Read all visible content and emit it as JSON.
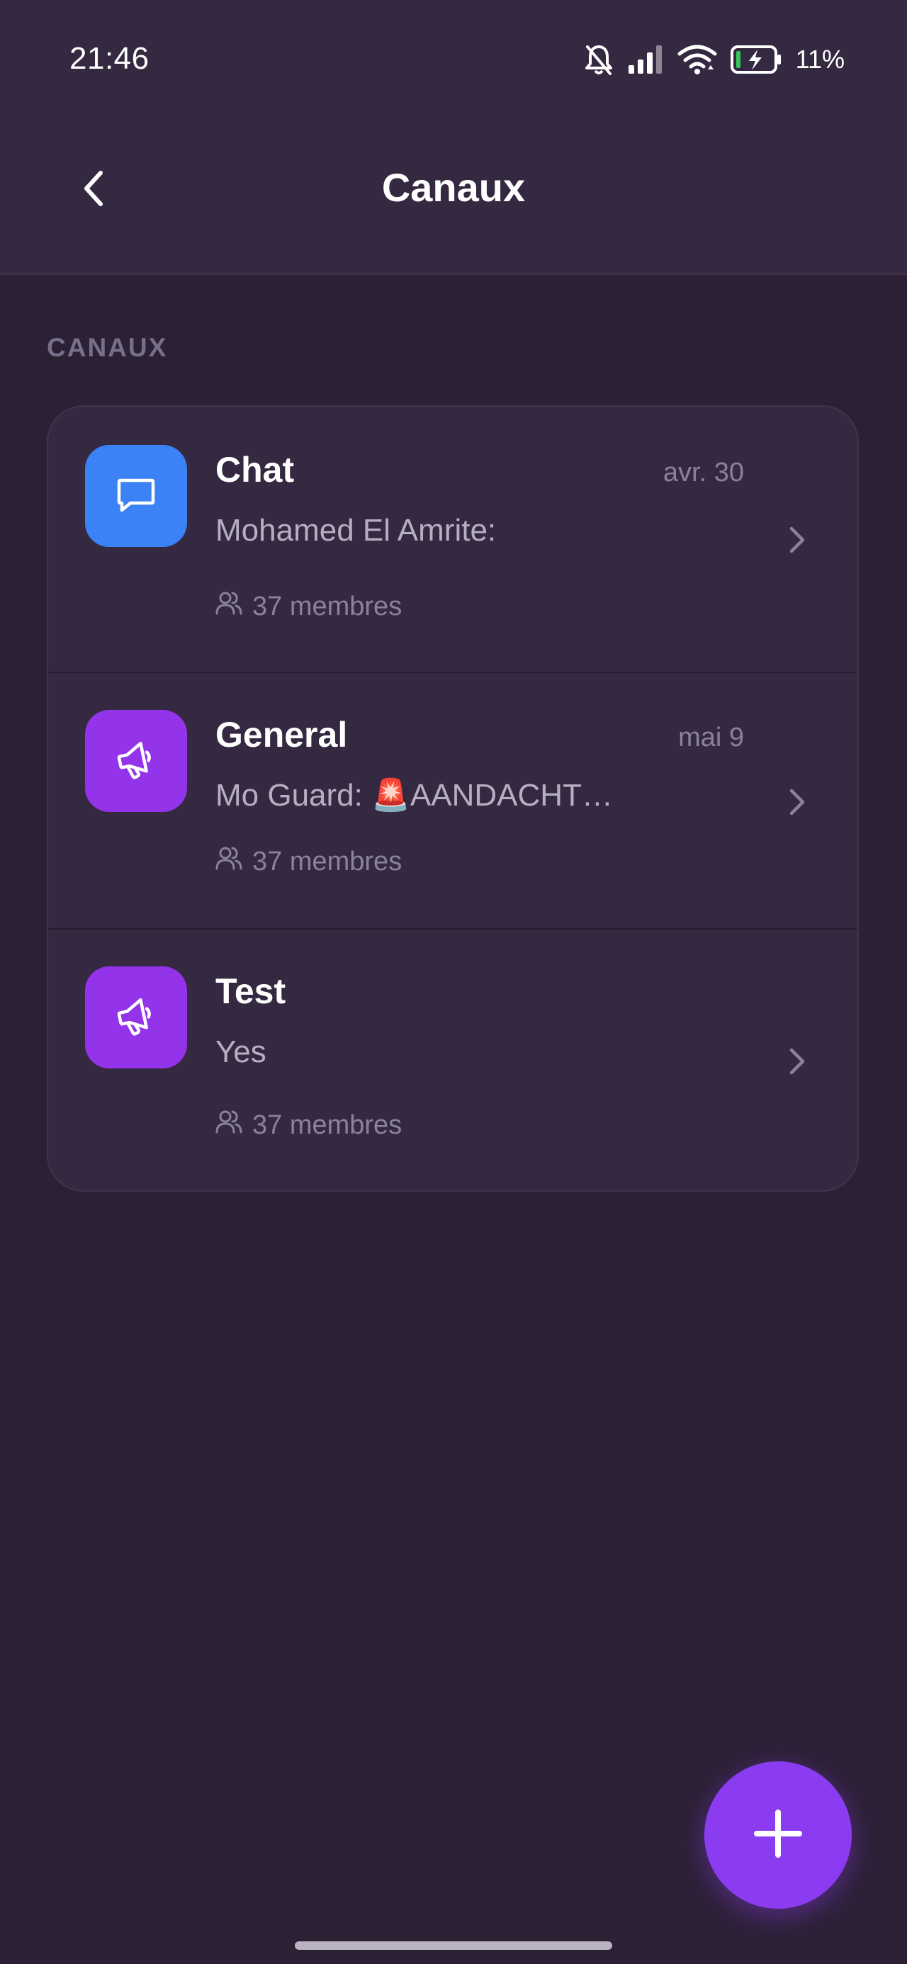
{
  "status_bar": {
    "time": "21:46",
    "battery_percent": "11%",
    "icons": [
      "bell-off-icon",
      "signal-icon",
      "wifi-icon",
      "battery-charging-icon"
    ]
  },
  "app_bar": {
    "title": "Canaux",
    "back_icon": "chevron-left-icon"
  },
  "section": {
    "label": "CANAUX"
  },
  "channels": [
    {
      "name": "Chat",
      "date": "avr. 30",
      "preview": "Mohamed El Amrite:",
      "members": "37 membres",
      "icon": "chat-bubble-icon",
      "icon_color": "#3b82f6"
    },
    {
      "name": "General",
      "date": "mai 9",
      "preview": "Mo Guard: 🚨AANDACHT…",
      "members": "37 membres",
      "icon": "megaphone-icon",
      "icon_color": "#9333ea"
    },
    {
      "name": "Test",
      "date": "",
      "preview": "Yes",
      "members": "37 membres",
      "icon": "megaphone-icon",
      "icon_color": "#9333ea"
    }
  ],
  "fab": {
    "icon": "plus-icon",
    "color": "#8b3cf0"
  }
}
